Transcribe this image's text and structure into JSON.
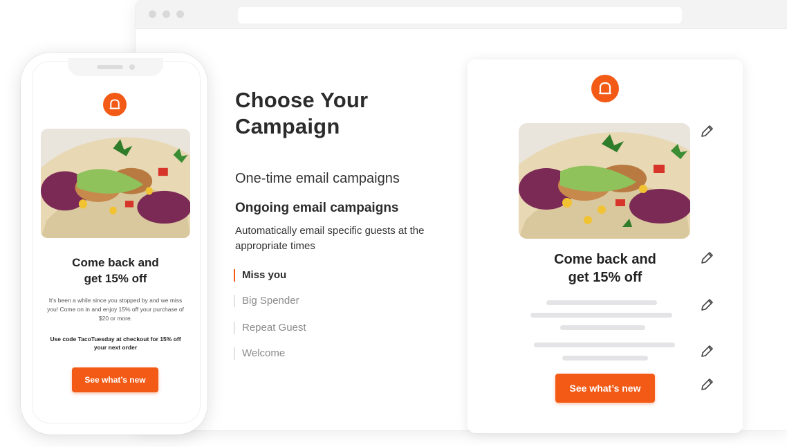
{
  "colors": {
    "brand_orange": "#f25a16",
    "active_marker": "#f25a16",
    "placeholder_gray": "#e4e4e6"
  },
  "campaign_menu": {
    "title": "Choose Your Campaign",
    "onetime_label": "One-time email campaigns",
    "ongoing_label": "Ongoing email campaigns",
    "ongoing_description": "Automatically email specific guests at the appropriate times",
    "items": [
      {
        "label": "Miss you",
        "active": true
      },
      {
        "label": "Big Spender",
        "active": false
      },
      {
        "label": "Repeat Guest",
        "active": false
      },
      {
        "label": "Welcome",
        "active": false
      }
    ]
  },
  "email_editor": {
    "logo_icon": "restaurant-logo-icon",
    "image_alt": "taco-photo",
    "headline_line1": "Come back and",
    "headline_line2": "get 15% off",
    "cta_label": "See what’s new",
    "edit_icon": "pencil-icon"
  },
  "phone_preview": {
    "headline_line1": "Come back and",
    "headline_line2": "get 15% off",
    "body_text": "It’s been a while since you stopped by and we miss you! Come on in and enjoy 15% off your purchase of $20 or more.",
    "code_prefix": "Use code ",
    "code": "TacoTuesday",
    "code_suffix": " at checkout for 15% off your next order",
    "cta_label": "See what’s new"
  }
}
